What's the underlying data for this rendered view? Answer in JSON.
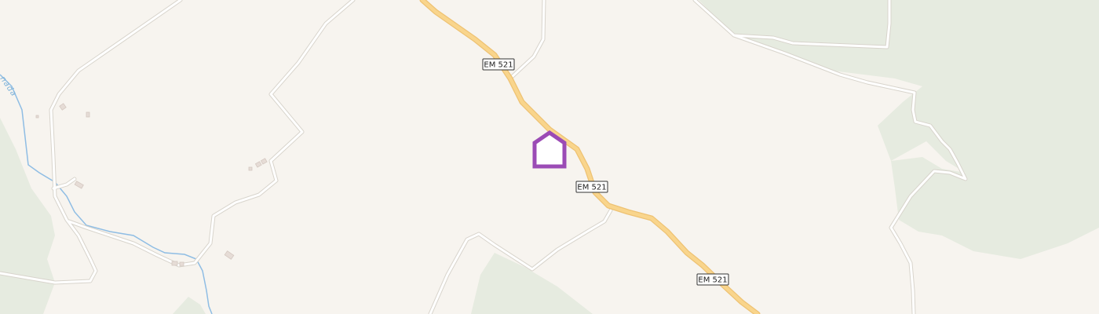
{
  "map": {
    "colors": {
      "land": "#f7f4ef",
      "forest": "#e6ebe0",
      "minor_road": "#ffffff",
      "minor_road_casing": "#d8d4cc",
      "main_road": "#f9d58c",
      "main_road_casing": "#eec273",
      "water": "#8fbde4",
      "building": "#e6dcd6",
      "marker": "#9b4bb5"
    },
    "road_shields": [
      {
        "id": "shield-1",
        "label": "EM 521"
      },
      {
        "id": "shield-2",
        "label": "EM 521"
      },
      {
        "id": "shield-3",
        "label": "EM 521"
      }
    ],
    "waterway_label": "nada",
    "marker": {
      "icon": "home-icon"
    }
  }
}
